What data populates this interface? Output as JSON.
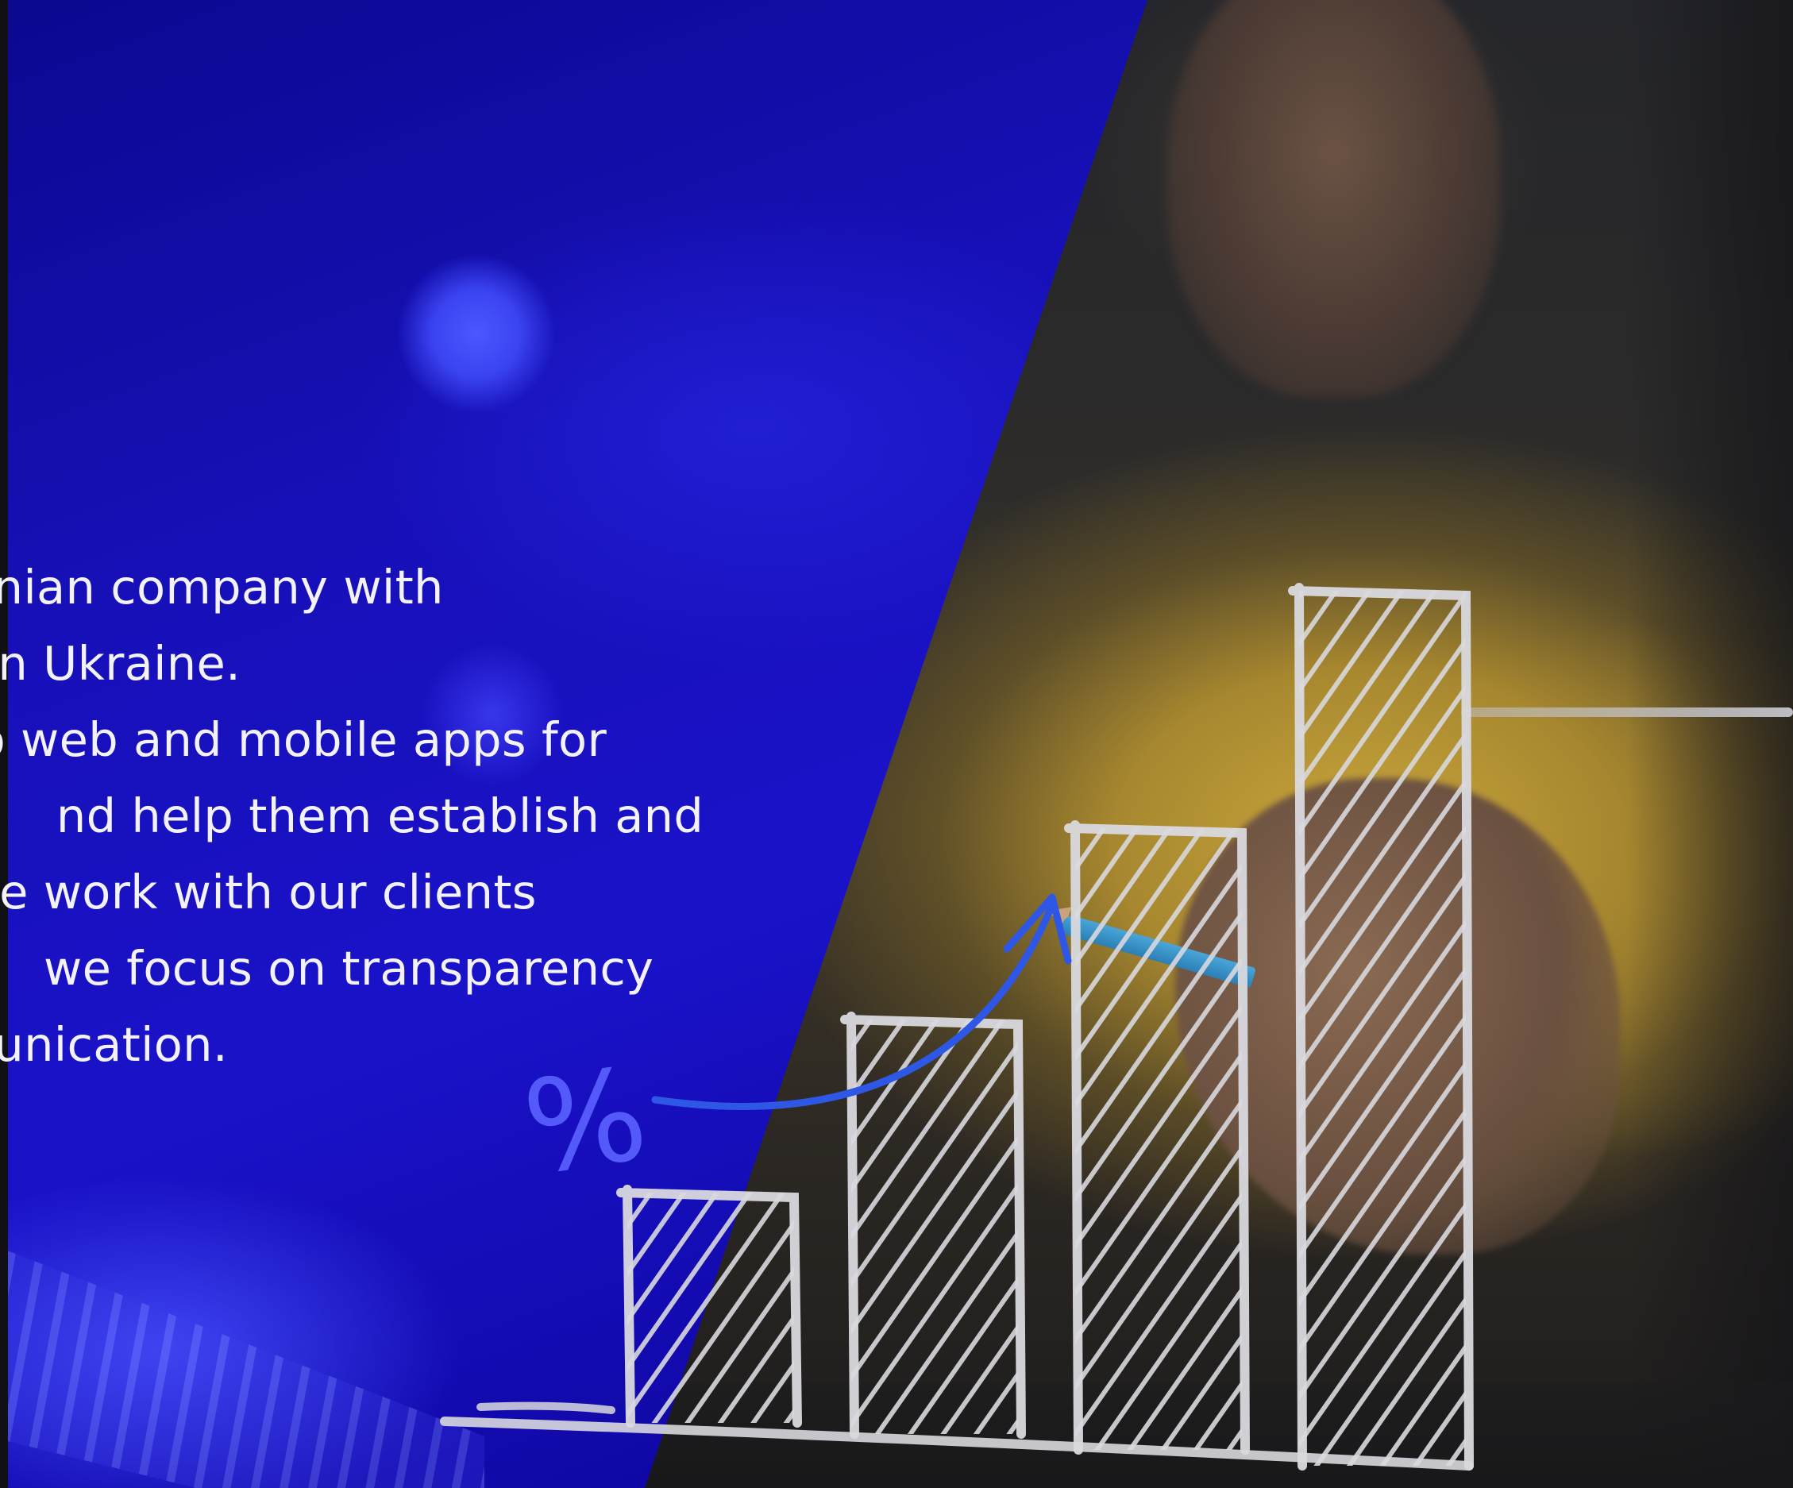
{
  "intro": {
    "lines": [
      "an Estonian company with",
      "center in Ukraine.",
      "develop web and mobile apps for",
      "startups and help them establish and",
      "Since we work with our clients",
      "remotely we focus on transparency",
      "communication."
    ],
    "visible_fragments": [
      "n Estonian company with",
      "er in Ukraine.",
      "op web and mobile apps for",
      "nd help them establish and",
      "ce we work with our clients",
      " we focus on transparency",
      "nunication."
    ]
  },
  "chart_sketch": {
    "type": "bar",
    "values": [
      1,
      1.8,
      2.7,
      3.8
    ],
    "percent_symbol": "%"
  },
  "colors": {
    "overlay_blue": "#1710b8",
    "shirt_yellow": "#c9a63d",
    "sketch_white": "#d9d9de",
    "arrow_blue": "#2f57e6",
    "pencil_blue": "#4aa6d9"
  }
}
